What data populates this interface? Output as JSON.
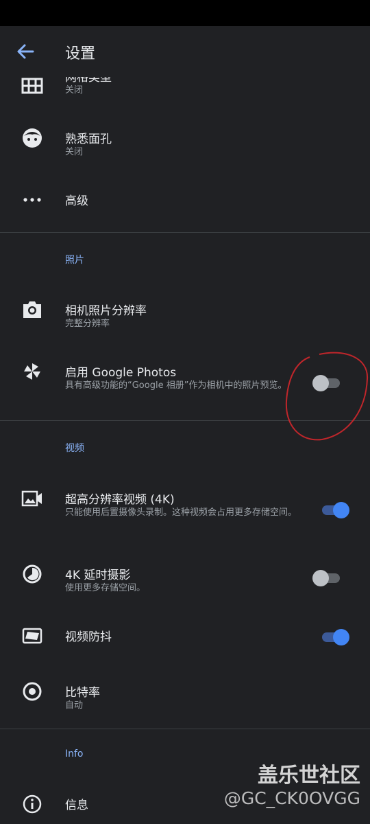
{
  "appbar": {
    "title": "设置"
  },
  "items": {
    "grid": {
      "label": "网格类型",
      "sub": "关闭"
    },
    "face": {
      "label": "熟悉面孔",
      "sub": "关闭"
    },
    "advanced": {
      "label": "高级"
    },
    "photo_res": {
      "label": "相机照片分辨率",
      "sub": "完整分辨率"
    },
    "google_photos": {
      "label": "启用 Google Photos",
      "sub": "具有高级功能的“Google 相册”作为相机中的照片预览。",
      "enabled": false
    },
    "video_4k": {
      "label": "超高分辨率视频 (4K)",
      "sub": "只能使用后置摄像头录制。这种视频会占用更多存储空间。",
      "enabled": true
    },
    "timelapse_4k": {
      "label": "4K 延时摄影",
      "sub": "使用更多存储空间。",
      "enabled": false
    },
    "stabilization": {
      "label": "视频防抖",
      "enabled": true
    },
    "bitrate": {
      "label": "比特率",
      "sub": "自动"
    },
    "info": {
      "label": "信息"
    }
  },
  "sections": {
    "photo": "照片",
    "video": "视频",
    "info": "Info"
  },
  "watermark": {
    "line1": "盖乐世社区",
    "line2": "@GC_CK0OVGG"
  },
  "colors": {
    "accent": "#8ab4f8",
    "toggle_on": "#4285f4",
    "annotation": "#c0262b",
    "background": "#202124"
  },
  "icons": [
    "back-arrow-icon",
    "grid-icon",
    "face-icon",
    "more-horiz-icon",
    "camera-icon",
    "pinwheel-icon",
    "video-camera-icon",
    "timelapse-icon",
    "stabilization-icon",
    "radio-target-icon",
    "info-icon"
  ]
}
